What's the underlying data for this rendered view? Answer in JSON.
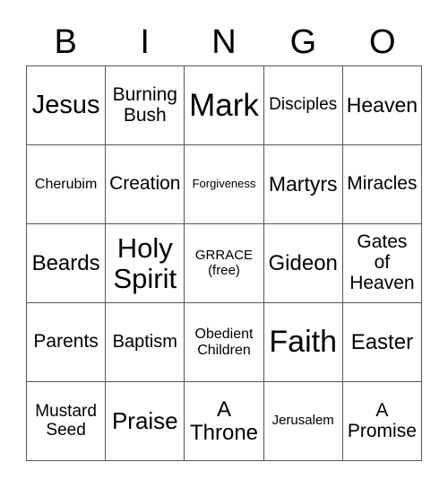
{
  "header": [
    "B",
    "I",
    "N",
    "G",
    "O"
  ],
  "cells": [
    [
      {
        "text": "Jesus",
        "size": 29
      },
      {
        "text": "Burning\nBush",
        "size": 21
      },
      {
        "text": "Mark",
        "size": 35
      },
      {
        "text": "Disciples",
        "size": 19
      },
      {
        "text": "Heaven",
        "size": 23
      }
    ],
    [
      {
        "text": "Cherubim",
        "size": 16
      },
      {
        "text": "Creation",
        "size": 21
      },
      {
        "text": "Forgiveness",
        "size": 13
      },
      {
        "text": "Martyrs",
        "size": 23
      },
      {
        "text": "Miracles",
        "size": 21
      }
    ],
    [
      {
        "text": "Beards",
        "size": 24
      },
      {
        "text": "Holy\nSpirit",
        "size": 31
      },
      {
        "text": "GRRACE\n(free)",
        "size": 15
      },
      {
        "text": "Gideon",
        "size": 24
      },
      {
        "text": "Gates\nof\nHeaven",
        "size": 21
      }
    ],
    [
      {
        "text": "Parents",
        "size": 21
      },
      {
        "text": "Baptism",
        "size": 20
      },
      {
        "text": "Obedient\nChildren",
        "size": 16
      },
      {
        "text": "Faith",
        "size": 34
      },
      {
        "text": "Easter",
        "size": 24
      }
    ],
    [
      {
        "text": "Mustard\nSeed",
        "size": 19
      },
      {
        "text": "Praise",
        "size": 26
      },
      {
        "text": "A\nThrone",
        "size": 24
      },
      {
        "text": "Jerusalem",
        "size": 15
      },
      {
        "text": "A\nPromise",
        "size": 21
      }
    ]
  ]
}
